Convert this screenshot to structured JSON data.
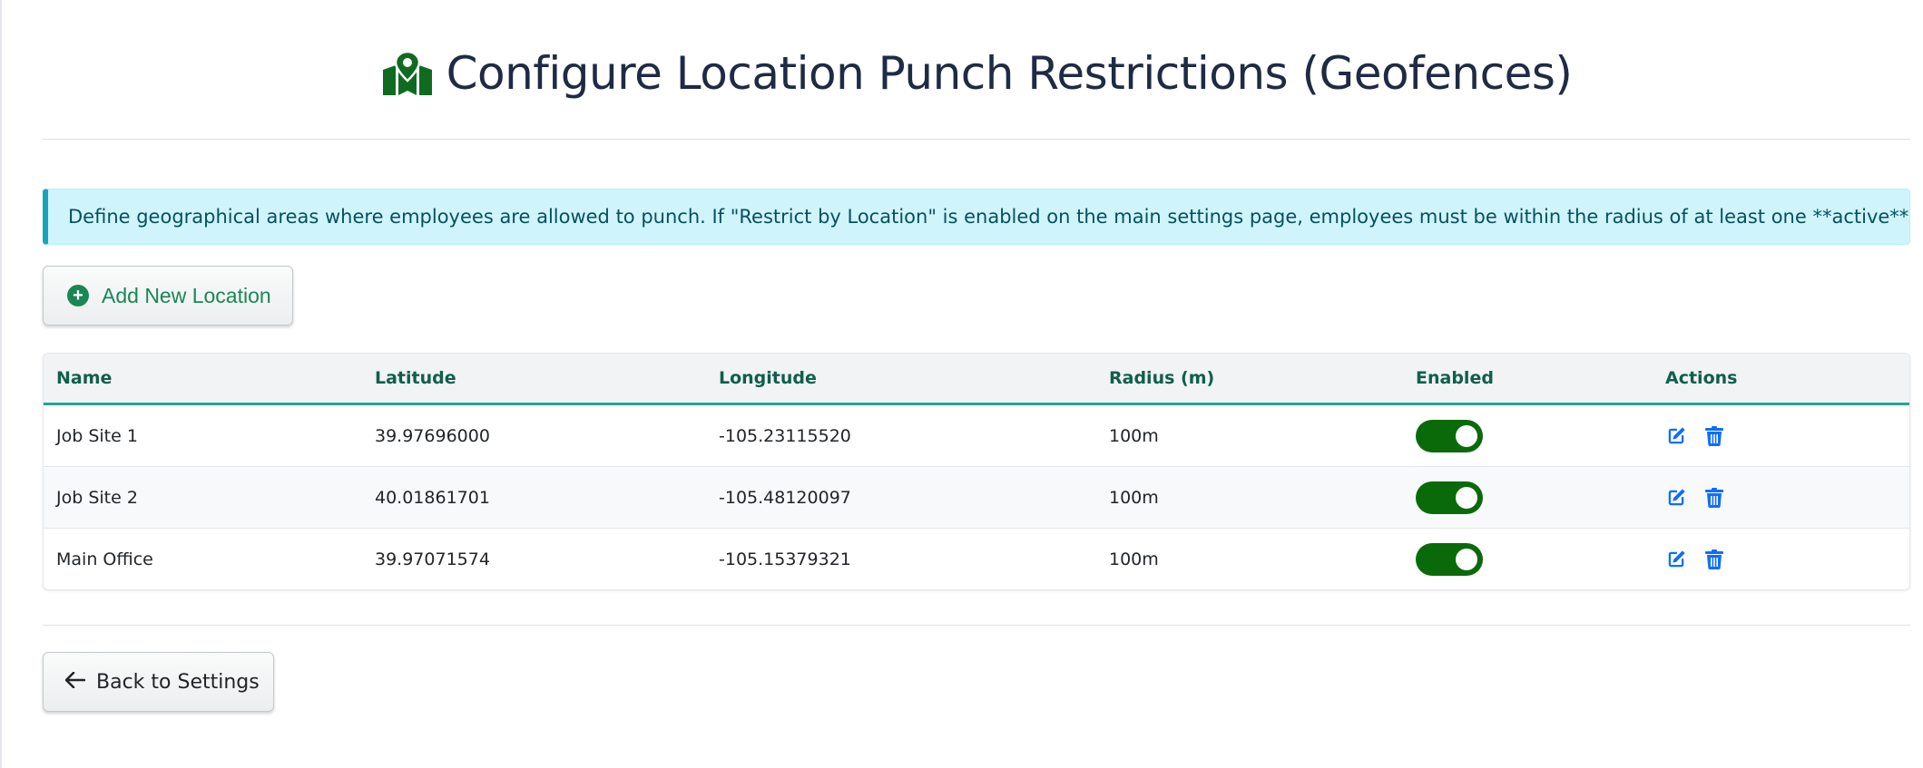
{
  "header": {
    "title": "Configure Location Punch Restrictions (Geofences)",
    "icon": "map-location-icon"
  },
  "alert": {
    "text": "Define geographical areas where employees are allowed to punch. If \"Restrict by Location\" is enabled on the main settings page, employees must be within the radius of at least one **active** geofence to punch."
  },
  "add_button": {
    "label": "Add New Location",
    "icon": "plus-circle-icon"
  },
  "table": {
    "columns": [
      "Name",
      "Latitude",
      "Longitude",
      "Radius (m)",
      "Enabled",
      "Actions"
    ],
    "rows": [
      {
        "name": "Job Site 1",
        "latitude": "39.97696000",
        "longitude": "-105.23115520",
        "radius": "100m",
        "enabled": true
      },
      {
        "name": "Job Site 2",
        "latitude": "40.01861701",
        "longitude": "-105.48120097",
        "radius": "100m",
        "enabled": true
      },
      {
        "name": "Main Office",
        "latitude": "39.97071574",
        "longitude": "-105.15379321",
        "radius": "100m",
        "enabled": true
      }
    ]
  },
  "back_button": {
    "label": "Back to Settings",
    "icon": "arrow-left-icon"
  },
  "colors": {
    "primary_green": "#0a6a0a",
    "success_text": "#198754",
    "header_accent": "#21a892",
    "action_blue": "#0d6efd",
    "alert_bg": "#cff4fc"
  }
}
